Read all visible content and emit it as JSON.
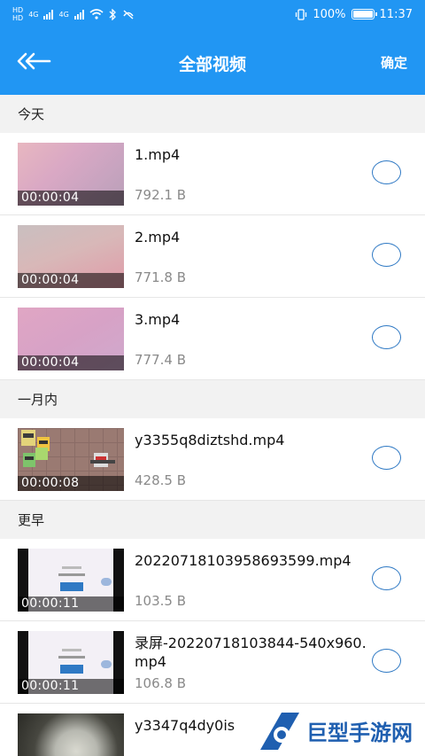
{
  "status_bar": {
    "left_labels": [
      "HD",
      "4G",
      "4G"
    ],
    "battery_text": "100%",
    "battery_level": 1.0,
    "time": "11:37"
  },
  "app_bar": {
    "back_icon": "double-chevron-left-icon",
    "title": "全部视频",
    "confirm_label": "确定"
  },
  "sections": [
    {
      "label": "今天",
      "items": [
        {
          "name": "1.mp4",
          "size": "792.1 B",
          "duration": "00:00:04"
        },
        {
          "name": "2.mp4",
          "size": "771.8 B",
          "duration": "00:00:04"
        },
        {
          "name": "3.mp4",
          "size": "777.4 B",
          "duration": "00:00:04"
        }
      ]
    },
    {
      "label": "一月内",
      "items": [
        {
          "name": "y3355q8diztshd.mp4",
          "size": "428.5 B",
          "duration": "00:00:08"
        }
      ]
    },
    {
      "label": "更早",
      "items": [
        {
          "name": "20220718103958693599.mp4",
          "size": "103.5 B",
          "duration": "00:00:11"
        },
        {
          "name": "录屏-20220718103844-540x960.mp4",
          "size": "106.8 B",
          "duration": "00:00:11"
        },
        {
          "name": "y3347q4dy0is",
          "size": "",
          "duration": ""
        }
      ]
    }
  ],
  "watermark": {
    "text": "巨型手游网"
  },
  "colors": {
    "primary": "#2196f3",
    "radio": "#2f79c4",
    "section_bg": "#f2f2f2"
  }
}
